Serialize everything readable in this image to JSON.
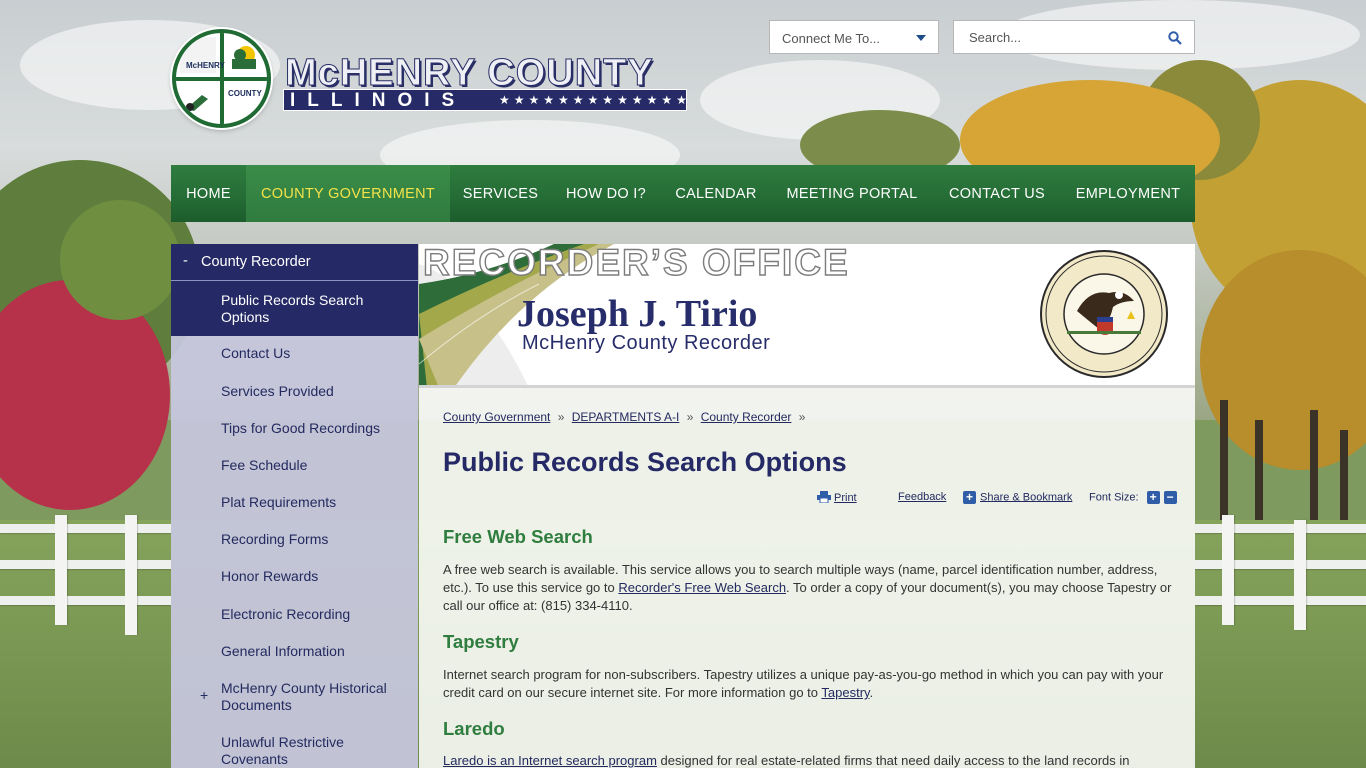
{
  "header": {
    "logo_seal_top": "McHENRY",
    "logo_seal_bottom": "COUNTY",
    "wordmark_title": "McHENRY COUNTY",
    "wordmark_state": "ILLINOIS",
    "wordmark_stars": "★★★★★★★★★★★★★",
    "connect_label": "Connect Me To...",
    "search_placeholder": "Search..."
  },
  "nav": {
    "items": [
      {
        "label": "HOME"
      },
      {
        "label": "COUNTY GOVERNMENT"
      },
      {
        "label": "SERVICES"
      },
      {
        "label": "HOW DO I?"
      },
      {
        "label": "CALENDAR"
      },
      {
        "label": "MEETING PORTAL"
      },
      {
        "label": "CONTACT US"
      },
      {
        "label": "EMPLOYMENT"
      }
    ],
    "active_index": 1
  },
  "sidebar": {
    "heading_toggle": "-",
    "heading": "County Recorder",
    "selected": "Public Records Search Options",
    "items": [
      {
        "label": "Contact Us"
      },
      {
        "label": "Services Provided"
      },
      {
        "label": "Tips for Good Recordings"
      },
      {
        "label": "Fee Schedule"
      },
      {
        "label": "Plat Requirements"
      },
      {
        "label": "Recording Forms"
      },
      {
        "label": "Honor Rewards"
      },
      {
        "label": "Electronic Recording"
      },
      {
        "label": "General Information"
      },
      {
        "label": "McHenry County Historical Documents",
        "toggle": "+"
      },
      {
        "label": "Unlawful Restrictive Covenants"
      }
    ]
  },
  "banner": {
    "office": "RECORDER’S OFFICE",
    "name": "Joseph J. Tirio",
    "role": "McHenry County Recorder",
    "seal_text_top": "SEAL OF THE COUNTY of McHENRY",
    "seal_text_bottom": "ILLINOIS",
    "seal_june": "JUNE",
    "seal_year": "1837"
  },
  "breadcrumb": {
    "items": [
      "County Government",
      "DEPARTMENTS A-I",
      "County Recorder"
    ],
    "separator": "»"
  },
  "page_title": "Public Records Search Options",
  "tools": {
    "print": "Print",
    "feedback": "Feedback",
    "share": "Share & Bookmark",
    "font_size": "Font Size:",
    "increase": "+",
    "decrease": "−"
  },
  "sections": {
    "free": {
      "heading": "Free Web Search",
      "text_1": "A free web search is available. This service allows you to search multiple ways (name, parcel identification number, address, etc.). To use this service go to ",
      "link": "Recorder's Free Web Search",
      "text_2": ". To order a copy of your document(s), you may choose Tapestry or call our office at: (815) 334-4110."
    },
    "tapestry": {
      "heading": "Tapestry",
      "text_1": "Internet search program for non-subscribers. Tapestry utilizes a unique pay-as-you-go method in which you can pay with your credit card on our secure internet site. For more information go to ",
      "link": "Tapestry",
      "text_2": "."
    },
    "laredo": {
      "heading": "Laredo",
      "link": "Laredo is an Internet search program",
      "text_1": " designed for real estate-related firms that need daily access to the land records in"
    }
  }
}
